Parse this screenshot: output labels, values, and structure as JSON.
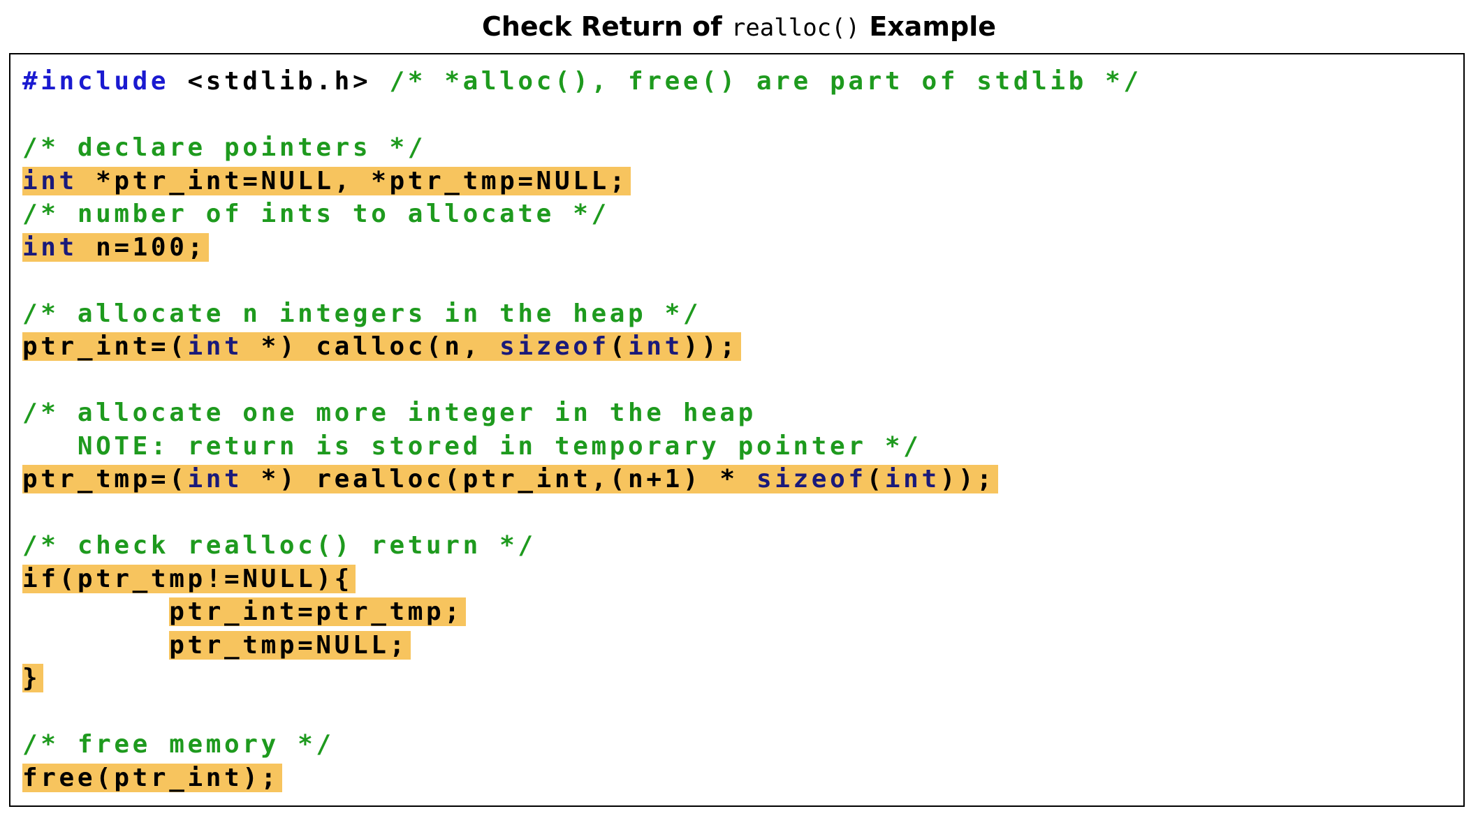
{
  "title": {
    "prefix": "Check Return of ",
    "code": "realloc()",
    "suffix": " Example"
  },
  "code": {
    "include_directive": "#include",
    "include_header": " <stdlib.h> ",
    "include_comment": "/* *alloc(), free() are part of stdlib */",
    "comment_declare": "/* declare pointers */",
    "decl_type": "int",
    "decl_rest": " *ptr_int=NULL, *ptr_tmp=NULL;",
    "comment_count": "/* number of ints to allocate */",
    "n_type": "int",
    "n_rest": " n=100;",
    "comment_allocate": "/* allocate n integers in the heap */",
    "calloc_a": "ptr_int=(",
    "calloc_type": "int",
    "calloc_b": " *) calloc(n, ",
    "calloc_sizeof": "sizeof",
    "calloc_c": "(",
    "calloc_type2": "int",
    "calloc_d": "));",
    "comment_realloc_1": "/* allocate one more integer in the heap",
    "comment_realloc_2": "   NOTE: return is stored in temporary pointer */",
    "realloc_a": "ptr_tmp=(",
    "realloc_type": "int",
    "realloc_b": " *) realloc(ptr_int,(n+1) * ",
    "realloc_sizeof": "sizeof",
    "realloc_c": "(",
    "realloc_type2": "int",
    "realloc_d": "));",
    "comment_check": "/* check realloc() return */",
    "if_kw": "if",
    "if_rest": "(ptr_tmp!=NULL){",
    "indent": "        ",
    "assign_int": "ptr_int=ptr_tmp;",
    "assign_tmp": "ptr_tmp=NULL;",
    "close_brace": "}",
    "comment_free": "/* free memory */",
    "free_call": "free(ptr_int);"
  }
}
